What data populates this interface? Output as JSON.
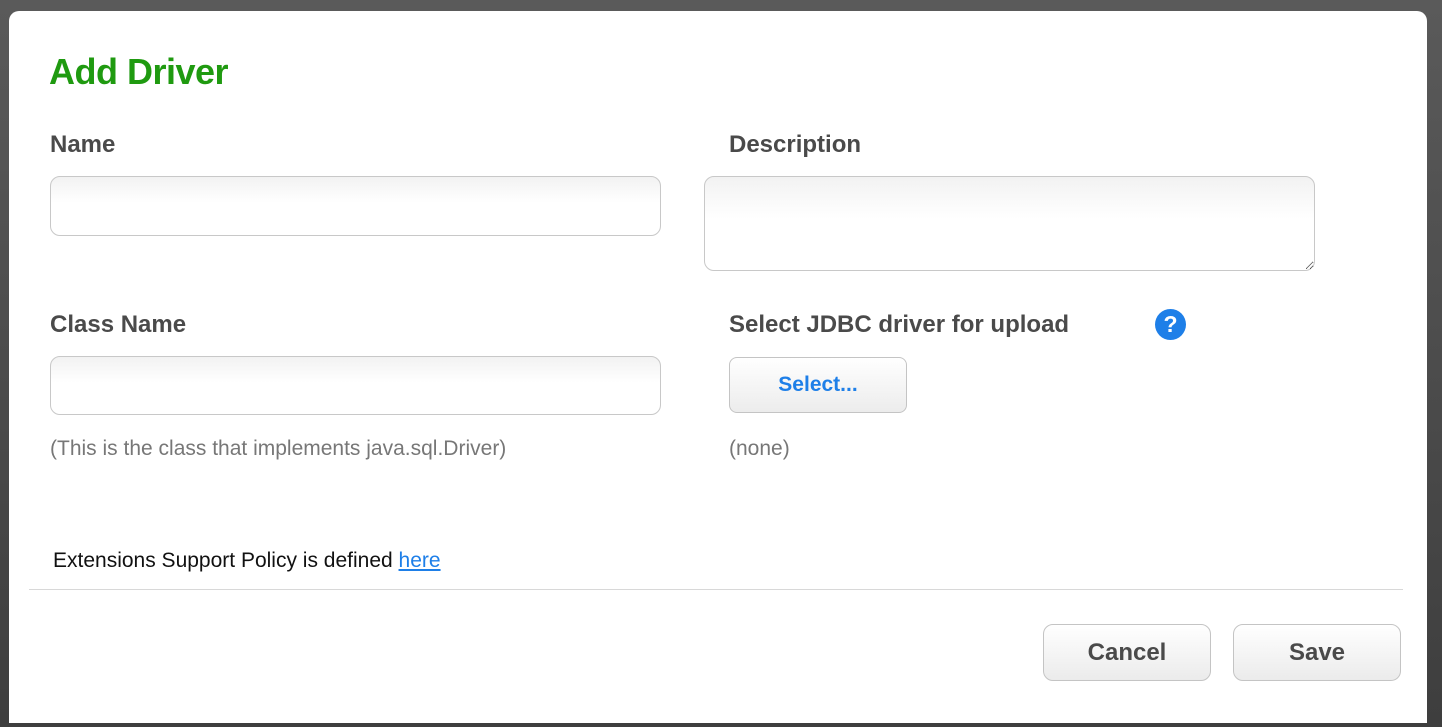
{
  "dialog": {
    "title": "Add Driver"
  },
  "fields": {
    "name": {
      "label": "Name",
      "value": ""
    },
    "description": {
      "label": "Description",
      "value": ""
    },
    "class_name": {
      "label": "Class Name",
      "value": "",
      "help": "(This is the class that implements java.sql.Driver)"
    },
    "jdbc_upload": {
      "label": "Select JDBC driver for upload",
      "help_icon": "question-mark-icon",
      "help_glyph": "?",
      "button_label": "Select...",
      "selected_file": "(none)"
    }
  },
  "policy": {
    "text": "Extensions Support Policy is defined ",
    "link_label": "here"
  },
  "footer": {
    "cancel_label": "Cancel",
    "save_label": "Save"
  },
  "colors": {
    "title": "#1f9a10",
    "link": "#1e7fe8",
    "label": "#4a4a4a",
    "help_text": "#777777"
  }
}
